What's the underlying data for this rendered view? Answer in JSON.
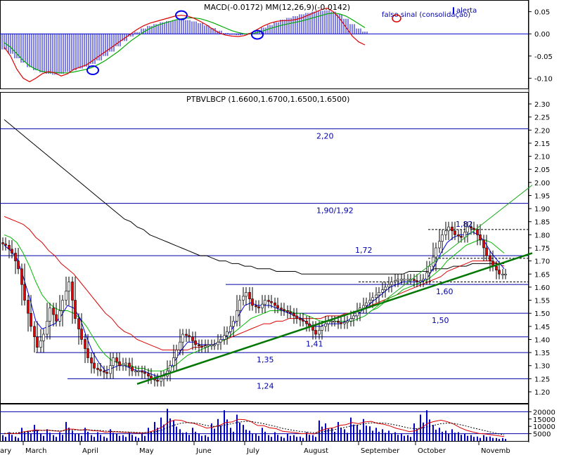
{
  "chart_data": {
    "type": "candlestick",
    "title": "PTBVLBCP (1.6600,1.6700,1.6500,1.6500)",
    "macd": {
      "title": "MACD(-0.0172) MM(12,26,9)(-0.0142)",
      "annotations": [
        "falso sinal (consolidação)",
        "alerta"
      ],
      "ylim": [
        -0.12,
        0.07
      ],
      "ticks": [
        "0.05",
        "0.00",
        "-0.05",
        "-0.10"
      ],
      "tick_values": [
        0.05,
        0.0,
        -0.05,
        -0.1
      ],
      "histogram": [
        -0.035,
        -0.045,
        -0.055,
        -0.065,
        -0.075,
        -0.082,
        -0.087,
        -0.09,
        -0.092,
        -0.09,
        -0.086,
        -0.082,
        -0.078,
        -0.074,
        -0.068,
        -0.06,
        -0.05,
        -0.04,
        -0.028,
        -0.016,
        -0.006,
        0.004,
        0.012,
        0.018,
        0.022,
        0.026,
        0.029,
        0.031,
        0.032,
        0.031,
        0.028,
        0.024,
        0.019,
        0.013,
        0.007,
        0.002,
        -0.002,
        -0.003,
        -0.002,
        0.002,
        0.008,
        0.014,
        0.02,
        0.026,
        0.032,
        0.036,
        0.04,
        0.044,
        0.047,
        0.05,
        0.052,
        0.053,
        0.05,
        0.044,
        0.034,
        0.022,
        0.012,
        0.005
      ],
      "macd_line": [
        -0.03,
        -0.05,
        -0.08,
        -0.1,
        -0.108,
        -0.1,
        -0.09,
        -0.085,
        -0.088,
        -0.095,
        -0.09,
        -0.08,
        -0.075,
        -0.07,
        -0.06,
        -0.05,
        -0.04,
        -0.03,
        -0.02,
        -0.01,
        0.0,
        0.01,
        0.018,
        0.024,
        0.028,
        0.032,
        0.036,
        0.04,
        0.042,
        0.04,
        0.035,
        0.028,
        0.02,
        0.01,
        0.002,
        -0.003,
        -0.005,
        -0.006,
        -0.004,
        0.002,
        0.01,
        0.018,
        0.024,
        0.028,
        0.03,
        0.03,
        0.032,
        0.036,
        0.042,
        0.048,
        0.054,
        0.058,
        0.05,
        0.035,
        0.015,
        -0.005,
        -0.018,
        -0.025
      ],
      "signal_line": [
        -0.02,
        -0.03,
        -0.045,
        -0.06,
        -0.072,
        -0.08,
        -0.085,
        -0.087,
        -0.087,
        -0.088,
        -0.088,
        -0.086,
        -0.083,
        -0.08,
        -0.075,
        -0.068,
        -0.06,
        -0.05,
        -0.04,
        -0.028,
        -0.016,
        -0.006,
        0.004,
        0.012,
        0.018,
        0.023,
        0.027,
        0.031,
        0.034,
        0.036,
        0.036,
        0.034,
        0.03,
        0.025,
        0.019,
        0.013,
        0.007,
        0.003,
        0.0,
        0.0,
        0.003,
        0.007,
        0.012,
        0.016,
        0.02,
        0.023,
        0.026,
        0.029,
        0.033,
        0.037,
        0.041,
        0.045,
        0.047,
        0.045,
        0.04,
        0.032,
        0.023,
        0.014
      ],
      "circles": [
        {
          "index": 14,
          "value": -0.082
        },
        {
          "index": 28,
          "value": 0.042
        },
        {
          "index": 40,
          "value": -0.002
        }
      ]
    },
    "price": {
      "ylim": [
        1.18,
        2.32
      ],
      "ticks": [
        "2.30",
        "2.25",
        "2.20",
        "2.15",
        "2.10",
        "2.05",
        "2.00",
        "1.95",
        "1.90",
        "1.85",
        "1.80",
        "1.75",
        "1.70",
        "1.65",
        "1.60",
        "1.55",
        "1.50",
        "1.45",
        "1.40",
        "1.35",
        "1.30",
        "1.25",
        "1.20"
      ],
      "tick_values": [
        2.3,
        2.25,
        2.2,
        2.15,
        2.1,
        2.05,
        2.0,
        1.95,
        1.9,
        1.85,
        1.8,
        1.75,
        1.7,
        1.65,
        1.6,
        1.55,
        1.5,
        1.45,
        1.4,
        1.35,
        1.3,
        1.25,
        1.2
      ],
      "levels": [
        {
          "value": 2.205,
          "label": "2,20"
        },
        {
          "value": 1.92,
          "label": "1,90/1,92"
        },
        {
          "value": 1.72,
          "label": "1,72"
        },
        {
          "value": 1.61,
          "label": "1,60"
        },
        {
          "value": 1.5,
          "label": "1,50"
        },
        {
          "value": 1.41,
          "label": "1,41"
        },
        {
          "value": 1.35,
          "label": "1,35"
        },
        {
          "value": 1.25,
          "label": "1,24"
        },
        {
          "value": 1.82,
          "label": "1,82"
        }
      ],
      "close": [
        1.76,
        1.73,
        1.67,
        1.55,
        1.45,
        1.37,
        1.42,
        1.52,
        1.47,
        1.55,
        1.62,
        1.48,
        1.4,
        1.33,
        1.29,
        1.28,
        1.27,
        1.33,
        1.3,
        1.31,
        1.28,
        1.28,
        1.27,
        1.25,
        1.24,
        1.26,
        1.3,
        1.36,
        1.42,
        1.41,
        1.38,
        1.37,
        1.38,
        1.38,
        1.4,
        1.43,
        1.47,
        1.55,
        1.58,
        1.53,
        1.52,
        1.55,
        1.54,
        1.52,
        1.51,
        1.5,
        1.48,
        1.47,
        1.45,
        1.42,
        1.45,
        1.47,
        1.47,
        1.46,
        1.47,
        1.49,
        1.52,
        1.54,
        1.56,
        1.58,
        1.6,
        1.62,
        1.63,
        1.63,
        1.63,
        1.62,
        1.63,
        1.68,
        1.75,
        1.8,
        1.83,
        1.8,
        1.79,
        1.83,
        1.82,
        1.78,
        1.72,
        1.68,
        1.65,
        1.65
      ],
      "sma_fast": [
        1.76,
        1.74,
        1.71,
        1.64,
        1.56,
        1.47,
        1.44,
        1.45,
        1.46,
        1.49,
        1.53,
        1.52,
        1.48,
        1.41,
        1.35,
        1.31,
        1.28,
        1.29,
        1.3,
        1.3,
        1.29,
        1.28,
        1.28,
        1.27,
        1.26,
        1.26,
        1.28,
        1.32,
        1.36,
        1.39,
        1.39,
        1.38,
        1.38,
        1.38,
        1.39,
        1.41,
        1.44,
        1.49,
        1.53,
        1.54,
        1.53,
        1.53,
        1.53,
        1.52,
        1.51,
        1.5,
        1.49,
        1.48,
        1.46,
        1.45,
        1.45,
        1.46,
        1.46,
        1.46,
        1.47,
        1.48,
        1.5,
        1.52,
        1.54,
        1.56,
        1.58,
        1.6,
        1.61,
        1.62,
        1.62,
        1.62,
        1.62,
        1.64,
        1.68,
        1.73,
        1.77,
        1.79,
        1.8,
        1.8,
        1.81,
        1.8,
        1.77,
        1.73,
        1.7,
        1.67
      ],
      "sma_mid": [
        1.8,
        1.79,
        1.77,
        1.73,
        1.68,
        1.62,
        1.57,
        1.54,
        1.52,
        1.51,
        1.51,
        1.5,
        1.48,
        1.45,
        1.41,
        1.37,
        1.34,
        1.32,
        1.31,
        1.3,
        1.3,
        1.29,
        1.29,
        1.28,
        1.28,
        1.28,
        1.29,
        1.3,
        1.32,
        1.34,
        1.35,
        1.36,
        1.37,
        1.38,
        1.39,
        1.4,
        1.42,
        1.44,
        1.46,
        1.48,
        1.49,
        1.5,
        1.51,
        1.51,
        1.51,
        1.51,
        1.5,
        1.5,
        1.49,
        1.48,
        1.47,
        1.47,
        1.47,
        1.47,
        1.47,
        1.47,
        1.48,
        1.49,
        1.51,
        1.52,
        1.54,
        1.56,
        1.57,
        1.59,
        1.6,
        1.61,
        1.62,
        1.63,
        1.65,
        1.67,
        1.7,
        1.72,
        1.74,
        1.76,
        1.77,
        1.78,
        1.78,
        1.77,
        1.75,
        1.73
      ],
      "sma_slow": [
        1.87,
        1.86,
        1.85,
        1.84,
        1.82,
        1.79,
        1.77,
        1.74,
        1.72,
        1.69,
        1.67,
        1.65,
        1.62,
        1.59,
        1.56,
        1.53,
        1.5,
        1.48,
        1.45,
        1.43,
        1.42,
        1.4,
        1.39,
        1.38,
        1.37,
        1.36,
        1.36,
        1.36,
        1.36,
        1.36,
        1.37,
        1.37,
        1.38,
        1.38,
        1.39,
        1.4,
        1.41,
        1.42,
        1.43,
        1.44,
        1.45,
        1.46,
        1.46,
        1.47,
        1.47,
        1.48,
        1.48,
        1.48,
        1.48,
        1.48,
        1.48,
        1.49,
        1.49,
        1.49,
        1.5,
        1.5,
        1.51,
        1.52,
        1.53,
        1.54,
        1.55,
        1.56,
        1.57,
        1.58,
        1.59,
        1.6,
        1.61,
        1.62,
        1.63,
        1.64,
        1.66,
        1.67,
        1.68,
        1.69,
        1.7,
        1.7,
        1.7,
        1.7,
        1.69,
        1.68
      ],
      "sma_200": [
        2.24,
        2.22,
        2.2,
        2.18,
        2.16,
        2.14,
        2.12,
        2.1,
        2.08,
        2.06,
        2.04,
        2.02,
        2.0,
        1.98,
        1.96,
        1.94,
        1.92,
        1.9,
        1.88,
        1.86,
        1.85,
        1.83,
        1.82,
        1.8,
        1.79,
        1.78,
        1.77,
        1.76,
        1.75,
        1.74,
        1.73,
        1.72,
        1.72,
        1.71,
        1.7,
        1.7,
        1.69,
        1.69,
        1.68,
        1.68,
        1.67,
        1.67,
        1.67,
        1.66,
        1.66,
        1.66,
        1.66,
        1.65,
        1.65,
        1.65,
        1.65,
        1.65,
        1.65,
        1.65,
        1.65,
        1.65,
        1.65,
        1.65,
        1.65,
        1.65,
        1.65,
        1.65,
        1.65,
        1.65,
        1.66,
        1.66,
        1.66,
        1.66,
        1.67,
        1.67,
        1.67,
        1.68,
        1.68,
        1.68,
        1.69,
        1.69,
        1.69,
        1.69,
        1.69,
        1.69
      ],
      "trendlines": [
        {
          "from": {
            "index": 21,
            "value": 1.23
          },
          "to": {
            "index": 79,
            "value": 1.69
          },
          "color": "#007700"
        },
        {
          "from": {
            "index": 57,
            "value": 1.49
          },
          "to": {
            "index": 79,
            "value": 1.91
          },
          "color": "#22aa22"
        }
      ]
    },
    "volume": {
      "ticks": [
        "20000",
        "15000",
        "10000",
        "5000"
      ],
      "tick_values": [
        20000,
        15000,
        10000,
        5000
      ],
      "ylim": [
        0,
        24000
      ],
      "values": [
        4000,
        6000,
        3000,
        9000,
        7000,
        11000,
        5000,
        8000,
        4000,
        6000,
        13000,
        7000,
        5000,
        9000,
        4000,
        6000,
        3000,
        8000,
        5000,
        4000,
        6000,
        3000,
        5000,
        9000,
        13000,
        16000,
        22000,
        14000,
        8000,
        6000,
        9000,
        5000,
        4000,
        12000,
        15000,
        21000,
        9000,
        18000,
        11000,
        7000,
        5000,
        9000,
        4000,
        6000,
        3000,
        5000,
        4000,
        3000,
        6000,
        4000,
        14000,
        12000,
        9000,
        13000,
        8000,
        16000,
        11000,
        15000,
        10000,
        9000,
        8000,
        7000,
        6000,
        5000,
        4000,
        12000,
        18000,
        21000,
        11000,
        9000,
        7000,
        8000,
        6000,
        5000,
        4000,
        3000,
        4000,
        3000,
        2000,
        2000
      ],
      "ma": [
        5000,
        5200,
        5000,
        6200,
        6800,
        7600,
        7200,
        7400,
        6800,
        6600,
        8200,
        8000,
        7400,
        7800,
        7000,
        6800,
        6000,
        6400,
        6200,
        5800,
        5800,
        5400,
        5400,
        6200,
        7600,
        9600,
        13000,
        14400,
        14000,
        12600,
        12000,
        10400,
        8800,
        9400,
        10600,
        12600,
        13000,
        14800,
        14600,
        13200,
        10600,
        10400,
        9000,
        8400,
        6600,
        6200,
        5600,
        5000,
        5200,
        4800,
        7000,
        8400,
        9000,
        10600,
        11200,
        12600,
        11800,
        13000,
        13400,
        12000,
        11400,
        10200,
        8600,
        7600,
        6400,
        7000,
        9200,
        12200,
        13400,
        14200,
        13200,
        11600,
        9200,
        7400,
        6200,
        5200,
        4800,
        4200,
        3600,
        3000
      ],
      "ma2": [
        5200,
        5400,
        5600,
        6000,
        6400,
        7000,
        7200,
        7200,
        7000,
        6800,
        7400,
        7600,
        7600,
        7600,
        7400,
        7200,
        6800,
        6600,
        6400,
        6200,
        6000,
        5800,
        5600,
        5800,
        6400,
        7600,
        9400,
        11000,
        12200,
        12600,
        12400,
        11600,
        10600,
        10000,
        10200,
        11000,
        11800,
        12800,
        13400,
        13400,
        12600,
        11800,
        10800,
        9800,
        8600,
        7800,
        7000,
        6400,
        6000,
        5600,
        6000,
        6800,
        7600,
        8600,
        9400,
        10400,
        11000,
        11800,
        12400,
        12400,
        12200,
        11600,
        10800,
        9800,
        8800,
        8400,
        8800,
        9800,
        10800,
        11800,
        12200,
        12000,
        11200,
        10200,
        9000,
        8000,
        7000,
        6000,
        5000,
        4200
      ]
    },
    "x_axis": {
      "month_labels": [
        "ary",
        "March",
        "April",
        "May",
        "June",
        "July",
        "August",
        "September",
        "October",
        "Novemb"
      ],
      "month_start_index": [
        -1,
        3,
        12,
        21,
        30,
        38,
        47,
        56,
        65,
        75
      ]
    }
  }
}
